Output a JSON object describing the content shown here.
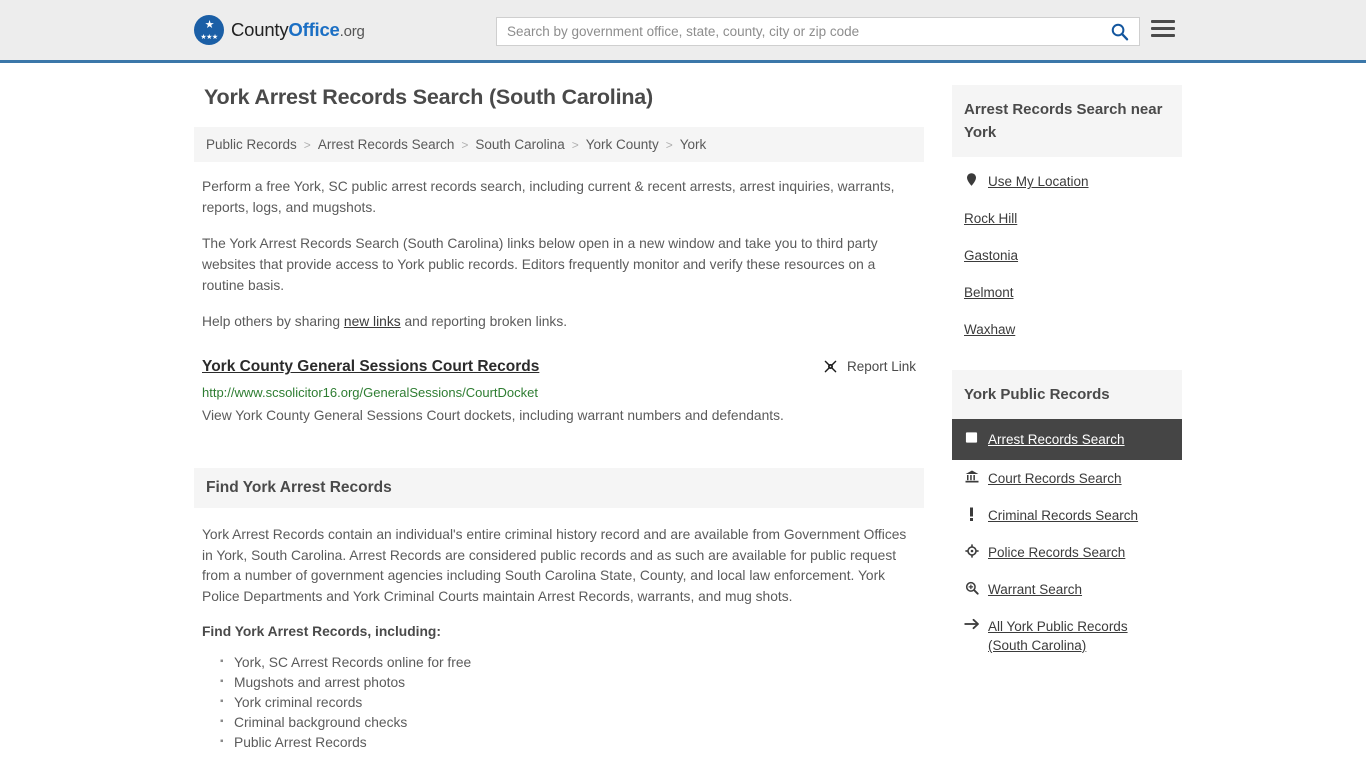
{
  "header": {
    "logo": {
      "part1": "County",
      "part2": "Office",
      "part3": ".org",
      "icon": "eagle-seal-icon"
    },
    "search": {
      "placeholder": "Search by government office, state, county, city or zip code",
      "value": "",
      "icon": "search-icon"
    },
    "menu_icon": "hamburger-menu-icon",
    "accent_color": "#3b77a9"
  },
  "main": {
    "title": "York Arrest Records Search (South Carolina)",
    "breadcrumb": [
      "Public Records",
      "Arrest Records Search",
      "South Carolina",
      "York County",
      "York"
    ],
    "breadcrumb_separator": ">",
    "intro_paragraphs": [
      "Perform a free York, SC public arrest records search, including current & recent arrests, arrest inquiries, warrants, reports, logs, and mugshots.",
      "The York Arrest Records Search (South Carolina) links below open in a new window and take you to third party websites that provide access to York public records. Editors frequently monitor and verify these resources on a routine basis."
    ],
    "share_line": {
      "before": "Help others by sharing ",
      "link": "new links",
      "after": " and reporting broken links."
    },
    "result": {
      "title": "York County General Sessions Court Records",
      "url": "http://www.scsolicitor16.org/GeneralSessions/CourtDocket",
      "url_color": "#2e7d32",
      "description": "View York County General Sessions Court dockets, including warrant numbers and defendants.",
      "report_label": "Report Link",
      "report_icon": "broken-link-icon"
    },
    "section": {
      "heading": "Find York Arrest Records",
      "paragraph": "York Arrest Records contain an individual's entire criminal history record and are available from Government Offices in York, South Carolina. Arrest Records are considered public records and as such are available for public request from a number of government agencies including South Carolina State, County, and local law enforcement. York Police Departments and York Criminal Courts maintain Arrest Records, warrants, and mug shots.",
      "subheading": "Find York Arrest Records, including:",
      "bullets": [
        "York, SC Arrest Records online for free",
        "Mugshots and arrest photos",
        "York criminal records",
        "Criminal background checks",
        "Public Arrest Records"
      ]
    }
  },
  "sidebar": {
    "nearby": {
      "heading": "Arrest Records Search near York",
      "items": [
        {
          "label": "Use My Location",
          "icon": "map-pin-icon"
        },
        {
          "label": "Rock Hill",
          "icon": ""
        },
        {
          "label": "Gastonia",
          "icon": ""
        },
        {
          "label": "Belmont",
          "icon": ""
        },
        {
          "label": "Waxhaw",
          "icon": ""
        }
      ]
    },
    "public_records": {
      "heading": "York Public Records",
      "active_bg": "#454545",
      "items": [
        {
          "label": "Arrest Records Search",
          "icon": "id-card-icon",
          "active": true
        },
        {
          "label": "Court Records Search",
          "icon": "bank-building-icon",
          "active": false
        },
        {
          "label": "Criminal Records Search",
          "icon": "exclamation-icon",
          "active": false
        },
        {
          "label": "Police Records Search",
          "icon": "police-badge-icon",
          "active": false
        },
        {
          "label": "Warrant Search",
          "icon": "magnifier-plus-icon",
          "active": false
        },
        {
          "label": "All York Public Records (South Carolina)",
          "icon": "arrow-right-icon",
          "active": false
        }
      ]
    }
  }
}
